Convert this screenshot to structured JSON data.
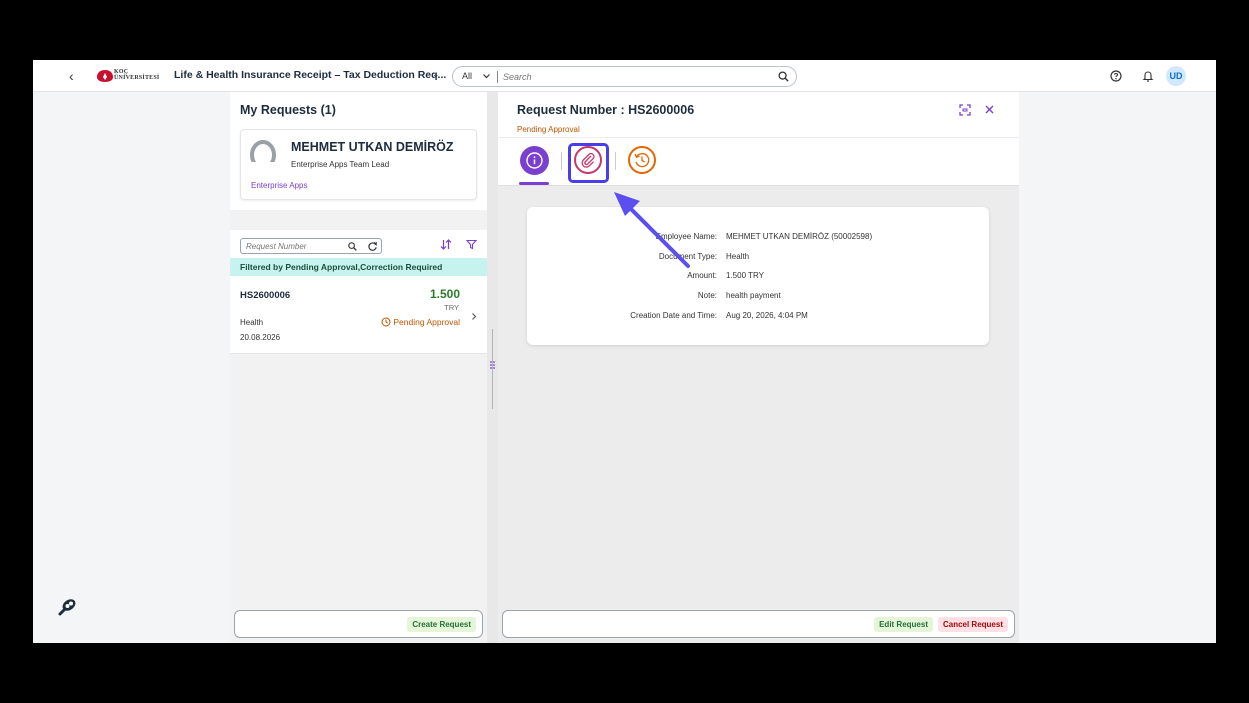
{
  "shell": {
    "back": "‹",
    "logo_line1": "KOÇ",
    "logo_line2": "ÜNİVERSİTESİ",
    "app_title": "Life & Health Insurance Receipt – Tax Deduction Req...",
    "title_chevron": "⌄",
    "search_scope": "All",
    "search_placeholder": "Search",
    "avatar_initials": "UD"
  },
  "list": {
    "title": "My Requests (1)",
    "profile": {
      "name": "MEHMET UTKAN DEMİRÖZ",
      "role": "Enterprise Apps Team Lead",
      "org": "Enterprise Apps"
    },
    "search_placeholder": "Request Number",
    "filter_info": "Filtered by Pending Approval,Correction Required",
    "items": [
      {
        "id": "HS2600006",
        "amount": "1.500",
        "currency": "TRY",
        "type": "Health",
        "date": "20.08.2026",
        "status": "Pending Approval"
      }
    ],
    "create_label": "Create Request"
  },
  "detail": {
    "title": "Request Number : HS2600006",
    "status": "Pending Approval",
    "fields": [
      {
        "label": "Employee Name:",
        "value": "MEHMET UTKAN DEMİRÖZ (50002598)"
      },
      {
        "label": "Document Type:",
        "value": "Health"
      },
      {
        "label": "Amount:",
        "value": "1.500 TRY"
      },
      {
        "label": "Note:",
        "value": "health payment"
      },
      {
        "label": "Creation Date and Time:",
        "value": "Aug 20, 2026, 4:04 PM"
      }
    ],
    "edit_label": "Edit Request",
    "cancel_label": "Cancel Request"
  },
  "colors": {
    "accent": "#7a3fd1",
    "highlight": "#4a3ee8",
    "pending": "#c35500",
    "amount": "#2b7d2b"
  }
}
